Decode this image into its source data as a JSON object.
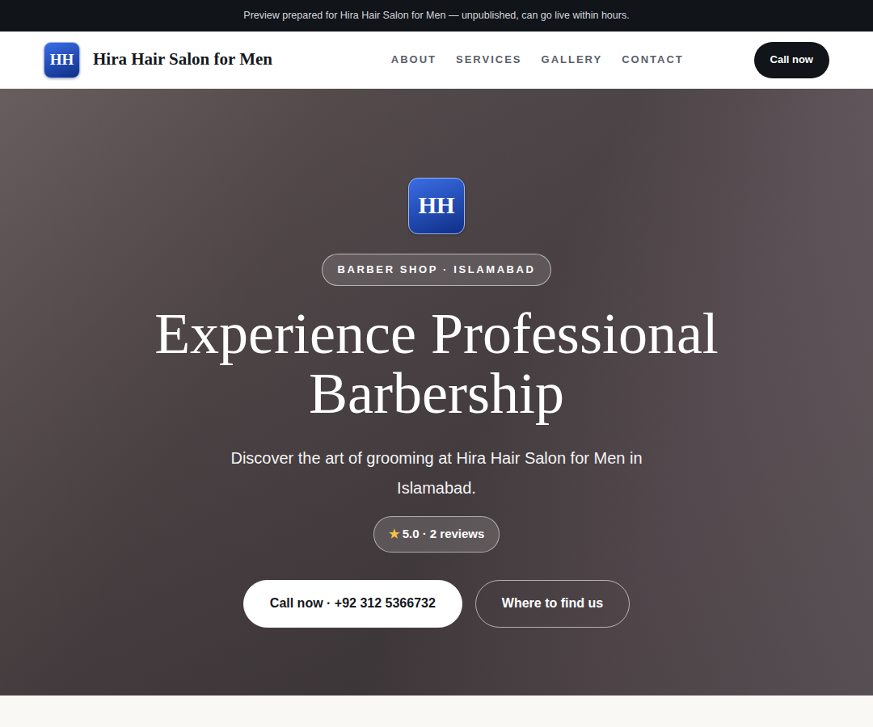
{
  "banner": {
    "text": "Preview prepared for Hira Hair Salon for Men — unpublished, can go live within hours."
  },
  "brand": {
    "logo": "HH",
    "name": "Hira Hair Salon for Men"
  },
  "nav": {
    "links": [
      {
        "label": "ABOUT"
      },
      {
        "label": "SERVICES"
      },
      {
        "label": "GALLERY"
      },
      {
        "label": "CONTACT"
      }
    ],
    "cta": "Call now"
  },
  "hero": {
    "logo": "HH",
    "tag": "BARBER SHOP · ISLAMABAD",
    "title": "Experience Professional Barbership",
    "subtitle": "Discover the art of grooming at Hira Hair Salon for Men in Islamabad.",
    "rating": {
      "star": "★",
      "text": "5.0 · 2 reviews"
    },
    "buttons": [
      {
        "label": "Call now · +92 312 5366732",
        "kind": "primary"
      },
      {
        "label": "Where to find us",
        "kind": "outline"
      }
    ]
  }
}
